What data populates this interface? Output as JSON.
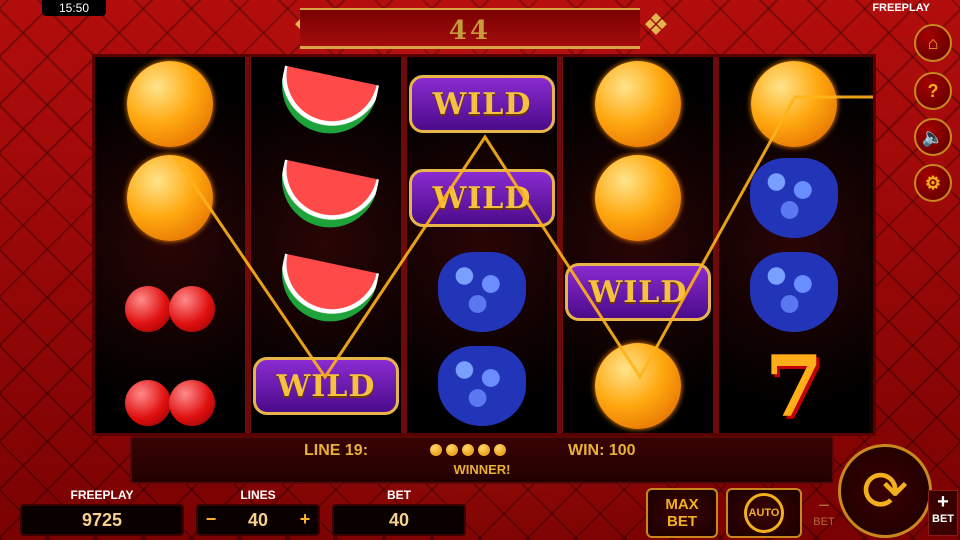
{
  "status": {
    "time": "15:50",
    "mode": "FREEPLAY"
  },
  "banner": {
    "value": "44"
  },
  "reels": [
    [
      "orange",
      "orange",
      "cherry",
      "cherry"
    ],
    [
      "watermelon",
      "watermelon",
      "watermelon",
      "wild"
    ],
    [
      "wild",
      "wild",
      "grapes",
      "grapes"
    ],
    [
      "orange",
      "orange",
      "wild",
      "orange"
    ],
    [
      "orange",
      "grapes",
      "grapes",
      "seven"
    ]
  ],
  "symbols": {
    "wild_label": "WILD",
    "seven_label": "7"
  },
  "win_panel": {
    "line_label": "LINE 19:",
    "win_label": "WIN: 100",
    "message": "WINNER!",
    "coins": 5
  },
  "credit": {
    "label": "FREEPLAY",
    "value": "9725"
  },
  "lines": {
    "label": "LINES",
    "value": "40",
    "minus": "−",
    "plus": "+"
  },
  "bet": {
    "label": "BET",
    "value": "40"
  },
  "controls": {
    "max_bet_1": "MAX",
    "max_bet_2": "BET",
    "auto": "AUTO",
    "bet_minus": "−",
    "bet_minus_label": "BET",
    "bet_plus": "+",
    "bet_plus_label": "BET"
  },
  "side_icons": [
    "home-icon",
    "help-icon",
    "sound-off-icon",
    "settings-icon"
  ],
  "colors": {
    "gold": "#e9b038",
    "bg": "#b30d0d"
  }
}
